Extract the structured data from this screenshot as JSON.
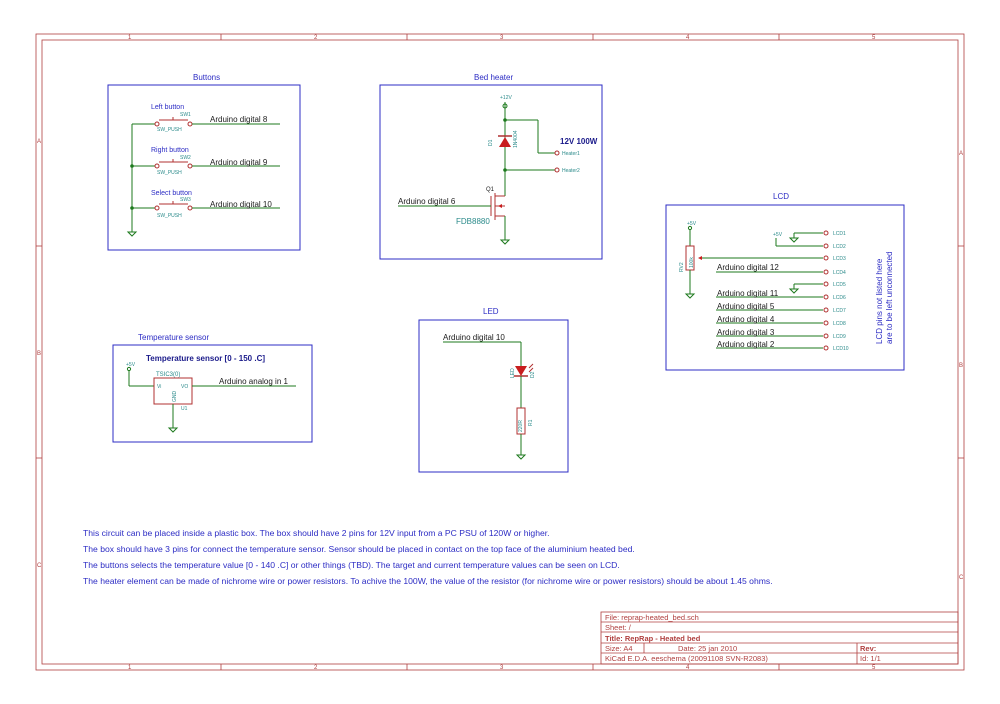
{
  "frame": {
    "col_labels": [
      "1",
      "2",
      "3",
      "4",
      "5"
    ],
    "row_labels": [
      "A",
      "B",
      "C"
    ]
  },
  "buttons": {
    "title": "Buttons",
    "items": [
      {
        "label": "Left button",
        "ref": "SW1",
        "type": "SW_PUSH",
        "net": "Arduino digital 8"
      },
      {
        "label": "Right button",
        "ref": "SW2",
        "type": "SW_PUSH",
        "net": "Arduino digital 9"
      },
      {
        "label": "Select button",
        "ref": "SW3",
        "type": "SW_PUSH",
        "net": "Arduino digital 10"
      }
    ]
  },
  "bed_heater": {
    "title": "Bed heater",
    "supply": "+12V",
    "power_label": "12V 100W",
    "diode_ref": "D1",
    "diode_value": "1N4004",
    "heater1": "Heater1",
    "heater2": "Heater2",
    "mosfet_ref": "Q1",
    "mosfet_part": "FDB8880",
    "net": "Arduino digital 6"
  },
  "lcd": {
    "title": "LCD",
    "rv_ref": "RV2",
    "rv_value": "100k",
    "supply": "+5V",
    "pins": [
      "LCD1",
      "LCD2",
      "LCD3",
      "LCD4",
      "LCD5",
      "LCD6",
      "LCD7",
      "LCD8",
      "LCD9",
      "LCD10"
    ],
    "nets": [
      "Arduino digital 12",
      "Arduino digital 11",
      "Arduino digital 5",
      "Arduino digital 4",
      "Arduino digital 3",
      "Arduino digital 2"
    ],
    "note_line1": "LCD pins not listed here",
    "note_line2": "are to be left unconnected"
  },
  "temp_sensor": {
    "title": "Temperature sensor",
    "heading": "Temperature sensor [0 - 150 .C]",
    "part": "TSIC3(0)",
    "ref": "U1",
    "pin_vi": "Vi",
    "pin_vo": "VO",
    "pin_gnd": "GND",
    "supply": "+5V",
    "net": "Arduino analog in 1"
  },
  "led": {
    "title": "LED",
    "net": "Arduino digital 10",
    "led_ref": "D2",
    "led_value": "LED",
    "res_ref": "R1",
    "res_value": "220R"
  },
  "notes": [
    "This circuit can be placed inside a plastic box. The box should have 2 pins for 12V input from a PC PSU of 120W or higher.",
    "The box should have 3 pins for connect the temperature sensor. Sensor should be placed in contact on the top face of the aluminium heated bed.",
    "The buttons selects the temperature value [0 - 140 .C] or other things (TBD). The target and current temperature values can be seen on LCD.",
    "The heater element can be made of nichrome wire or power resistors. To achive the 100W, the value of the resistor (for nichrome wire or power resistors) should be about 1.45 ohms."
  ],
  "title_block": {
    "file": "File: reprap-heated_bed.sch",
    "sheet": "Sheet: /",
    "title": "Title: RepRap - Heated bed",
    "size": "Size: A4",
    "date": "Date: 25 jan 2010",
    "rev": "Rev:",
    "tool": "KiCad E.D.A.  eeschema (20091108 SVN-R2083)",
    "id": "Id: 1/1"
  }
}
